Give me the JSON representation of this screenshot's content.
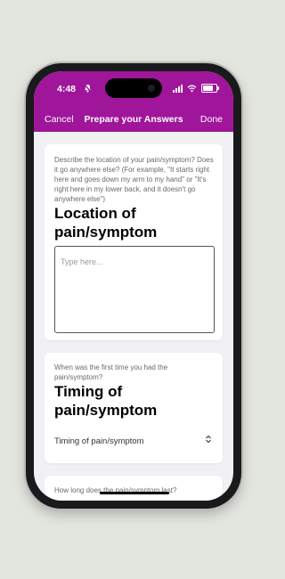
{
  "status_bar": {
    "time": "4:48",
    "bell_icon": "bell-slash-icon"
  },
  "nav": {
    "cancel_label": "Cancel",
    "title": "Prepare your Answers",
    "done_label": "Done"
  },
  "colors": {
    "brand": "#a0169b",
    "background": "#f1f1f4"
  },
  "cards": [
    {
      "description": "Describe the location of your pain/symptom? Does it go anywhere else? (For example, \"It starts right here and goes down my arm to my hand\" or \"It's right here in my lower back, and it doesn't go anywhere else\")",
      "title": "Location of pain/symptom",
      "input": {
        "value": "",
        "placeholder": "Type here..."
      }
    },
    {
      "description": "When was the first time you had the pain/symptom?",
      "title": "Timing of pain/symptom",
      "select": {
        "value": "Timing of pain/symptom"
      }
    },
    {
      "description": "How long does the pain/symptom last?"
    }
  ]
}
